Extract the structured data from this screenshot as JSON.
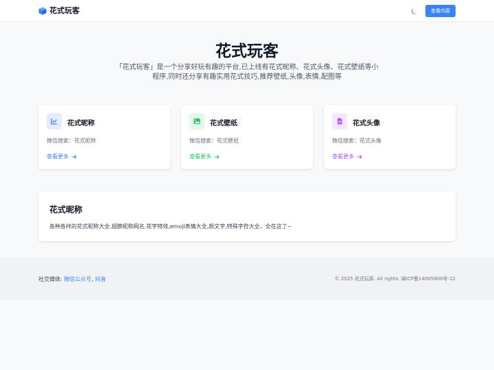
{
  "header": {
    "brand_name": "花式玩客",
    "brand_icon": "cube-icon",
    "theme_icon": "moon-icon",
    "view_button": "查看内容",
    "accent": "#3b82f6"
  },
  "hero": {
    "title": "花式玩客",
    "description": "「花式玩客」是一个分享好玩有趣的平台,已上线有花式昵称、花式头像、花式壁纸等小程序,同时还分享有趣实用花式技巧,推荐壁纸,头像,表情,配图等"
  },
  "cards": [
    {
      "title": "花式昵称",
      "subtitle": "微信搜索：花式昵称",
      "link": "查看更多",
      "icon": "chart-line-icon",
      "color": "#3b82f6",
      "bg": "#e5edfd"
    },
    {
      "title": "花式壁纸",
      "subtitle": "微信搜索：花式壁纸",
      "link": "查看更多",
      "icon": "image-icon",
      "color": "#22c55e",
      "bg": "#e3f7ea"
    },
    {
      "title": "花式头像",
      "subtitle": "微信搜索：花式头像",
      "link": "查看更多",
      "icon": "document-icon",
      "color": "#a855f7",
      "bg": "#f3e8fd"
    }
  ],
  "feature": {
    "title": "花式昵称",
    "text": "各种各样的花式昵称大全,翅膀昵称网名,花字特效,emoji表情大全,颜文字,特殊字符大全，全在这了~"
  },
  "footer": {
    "social_label": "社交媒体:",
    "social_links": [
      "微信公众号",
      "抖音"
    ],
    "separator": ",",
    "copyright": "© 2025 花式玩客. All rights. 闽ICP备14005900号-12"
  }
}
